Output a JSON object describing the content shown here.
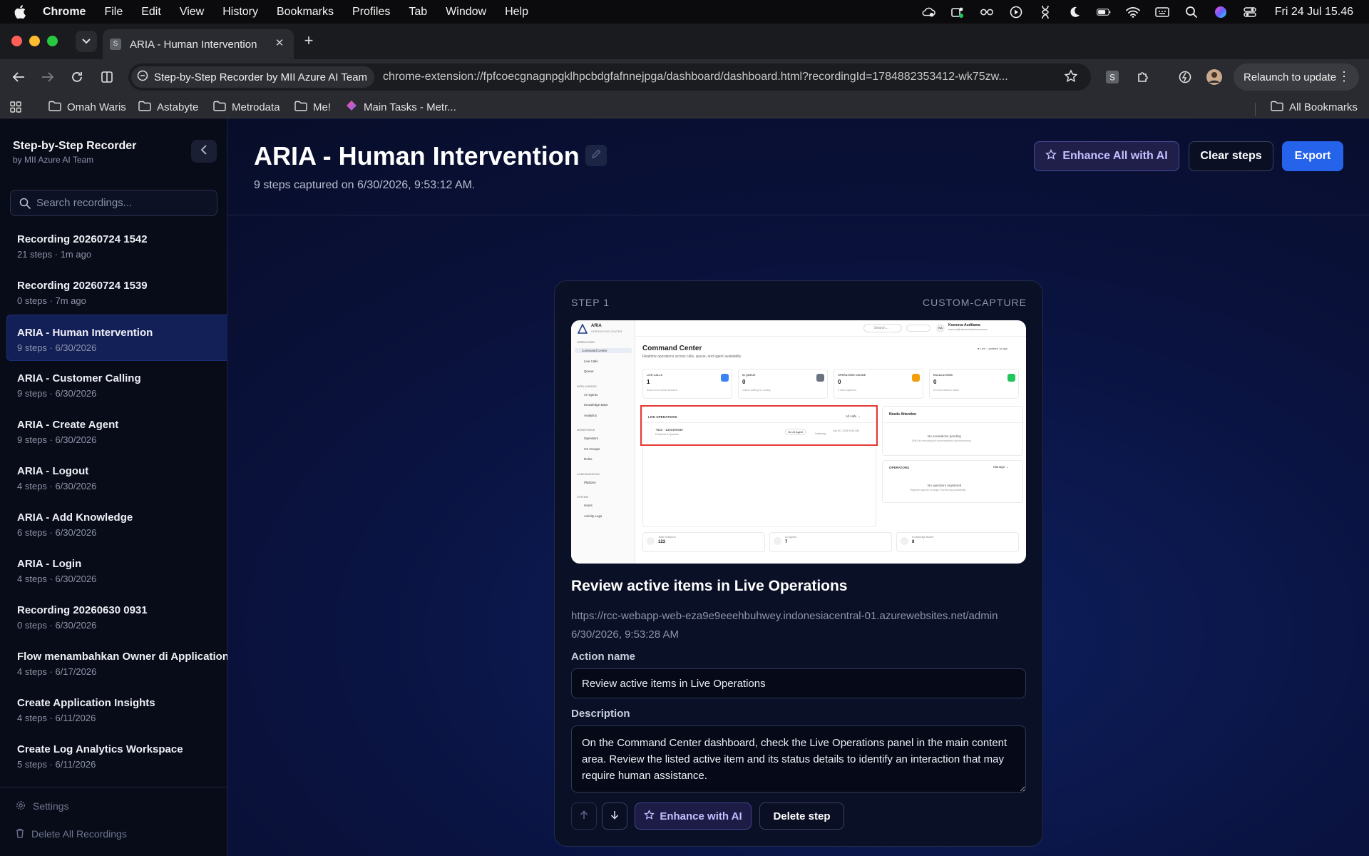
{
  "menubar": {
    "app": "Chrome",
    "items": [
      "File",
      "Edit",
      "View",
      "History",
      "Bookmarks",
      "Profiles",
      "Tab",
      "Window",
      "Help"
    ],
    "clock": "Fri 24 Jul  15.46"
  },
  "browser": {
    "tab_title": "ARIA - Human Intervention",
    "tab_favicon": "S",
    "site_chip": "Step-by-Step Recorder by MII Azure AI Team",
    "url": "chrome-extension://fpfcoecgnagnpgklhpcbdgfafnnejpga/dashboard/dashboard.html?recordingId=1784882353412-wk75zw...",
    "relaunch": "Relaunch to update",
    "bookmarks": [
      "Omah Waris",
      "Astabyte",
      "Metrodata",
      "Me!",
      "Main Tasks - Metr..."
    ],
    "all_bookmarks": "All Bookmarks"
  },
  "sidebar": {
    "title": "Step-by-Step Recorder",
    "subtitle": "by MII Azure AI Team",
    "search_placeholder": "Search recordings...",
    "recordings": [
      {
        "title": "Recording 20260724 1542",
        "meta": "21 steps · 1m ago"
      },
      {
        "title": "Recording 20260724 1539",
        "meta": "0 steps · 7m ago"
      },
      {
        "title": "ARIA - Human Intervention",
        "meta": "9 steps · 6/30/2026"
      },
      {
        "title": "ARIA - Customer Calling",
        "meta": "9 steps · 6/30/2026"
      },
      {
        "title": "ARIA - Create Agent",
        "meta": "9 steps · 6/30/2026"
      },
      {
        "title": "ARIA - Logout",
        "meta": "4 steps · 6/30/2026"
      },
      {
        "title": "ARIA - Add Knowledge",
        "meta": "6 steps · 6/30/2026"
      },
      {
        "title": "ARIA - Login",
        "meta": "4 steps · 6/30/2026"
      },
      {
        "title": "Recording 20260630 0931",
        "meta": "0 steps · 6/30/2026"
      },
      {
        "title": "Flow menambahkan Owner di Application",
        "meta": "4 steps · 6/17/2026"
      },
      {
        "title": "Create Application Insights",
        "meta": "4 steps · 6/11/2026"
      },
      {
        "title": "Create Log Analytics Workspace",
        "meta": "5 steps · 6/11/2026"
      }
    ],
    "settings": "Settings",
    "delete_all": "Delete All Recordings"
  },
  "main": {
    "title": "ARIA - Human Intervention",
    "subtitle": "9 steps captured on 6/30/2026, 9:53:12 AM.",
    "enhance_all": "Enhance All with AI",
    "clear_steps": "Clear steps",
    "export": "Export"
  },
  "step": {
    "label": "STEP 1",
    "type": "CUSTOM-CAPTURE",
    "title": "Review active items in Live Operations",
    "url": "https://rcc-webapp-web-eza9e9eeehbuhwey.indonesiacentral-01.azurewebsites.net/admin",
    "time": "6/30/2026, 9:53:28 AM",
    "action_label": "Action name",
    "action_value": "Review active items in Live Operations",
    "desc_label": "Description",
    "desc_value": "On the Command Center dashboard, check the Live Operations panel in the main content area. Review the listed active item and its status details to identify an interaction that may require human assistance.",
    "enhance": "Enhance with AI",
    "delete": "Delete step"
  },
  "thumb": {
    "brand": "ARIA",
    "brand_sub": "OPERATIONS CENTER",
    "search": "Search...",
    "user": "Ksenova Auditama",
    "user_email": "ksenova@mitrasolusiinformasi.com",
    "title": "Command Center",
    "subtitle": "Realtime operations across calls, queue, and agent availability",
    "live": "● Live · updated 1s ago",
    "nav_groups": [
      {
        "head": "OPERATIONS",
        "items": [
          "Command Center",
          "Live Calls",
          "Queue"
        ]
      },
      {
        "head": "INTELLIGENCE",
        "items": [
          "AI Agents",
          "Knowledge Base",
          "Analytics"
        ]
      },
      {
        "head": "WORKFORCE",
        "items": [
          "Operators",
          "CS Groups",
          "Roles"
        ]
      },
      {
        "head": "CONFIGURATION",
        "items": [
          "Platform"
        ]
      },
      {
        "head": "SYSTEM",
        "items": [
          "Users",
          "Activity Logs"
        ]
      }
    ],
    "stats": [
      {
        "label": "LIVE CALLS",
        "value": "1",
        "note": "Active AI & human sessions",
        "color": "#3b82f6"
      },
      {
        "label": "IN QUEUE",
        "value": "0",
        "note": "Callers waiting for routing",
        "color": "#6b7280"
      },
      {
        "label": "OPERATORS ONLINE",
        "value": "0",
        "note": "0 total registered",
        "color": "#f59e0b"
      },
      {
        "label": "ESCALATIONS",
        "value": "0",
        "note": "AI conversations stable",
        "color": "#22c55e"
      }
    ],
    "live_ops": "LIVE OPERATIONS",
    "all_calls": "All calls →",
    "op_row_title": "+623 · 13ee4e9c8e",
    "op_row_sub": "Products & Queries",
    "op_row_badge": "On AI Agent",
    "op_row_status": "Listening",
    "op_row_time": "Jun 30, 2026 9:53 AM",
    "needs_attention": "Needs Attention",
    "no_escalations": "No escalations pending",
    "no_escalations_sub": "ARIA is resolving all conversations autonomously",
    "operators": "OPERATORS",
    "manage": "Manage →",
    "no_operators": "No operators registered",
    "no_operators_sub": "Register agents to begin monitoring availability",
    "footer": [
      {
        "label": "Total Sessions",
        "value": "123"
      },
      {
        "label": "AI Agents",
        "value": "7"
      },
      {
        "label": "Knowledge Bases",
        "value": "8"
      }
    ]
  }
}
